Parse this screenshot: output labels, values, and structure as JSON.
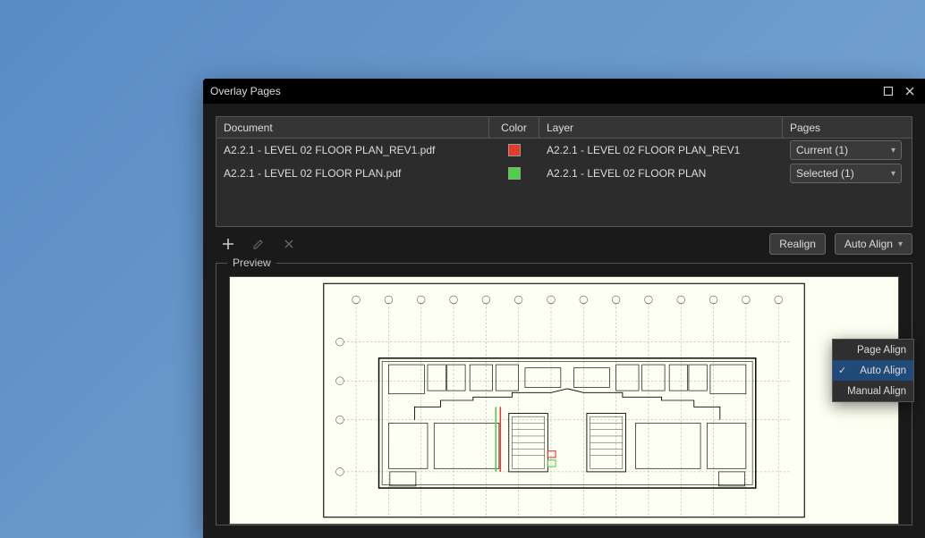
{
  "dialog": {
    "title": "Overlay Pages"
  },
  "table": {
    "headers": {
      "document": "Document",
      "color": "Color",
      "layer": "Layer",
      "pages": "Pages"
    },
    "rows": [
      {
        "document": "A2.2.1 - LEVEL 02 FLOOR PLAN_REV1.pdf",
        "color": "#e33b2d",
        "layer": "A2.2.1 - LEVEL 02 FLOOR PLAN_REV1",
        "pages": "Current (1)"
      },
      {
        "document": "A2.2.1 - LEVEL 02 FLOOR PLAN.pdf",
        "color": "#4fd04a",
        "layer": "A2.2.1 - LEVEL 02 FLOOR PLAN",
        "pages": "Selected (1)"
      }
    ]
  },
  "toolbar": {
    "realign": "Realign",
    "auto_align": "Auto Align"
  },
  "preview": {
    "label": "Preview"
  },
  "align_menu": {
    "options": [
      "Page Align",
      "Auto Align",
      "Manual Align"
    ],
    "selected": 1
  }
}
